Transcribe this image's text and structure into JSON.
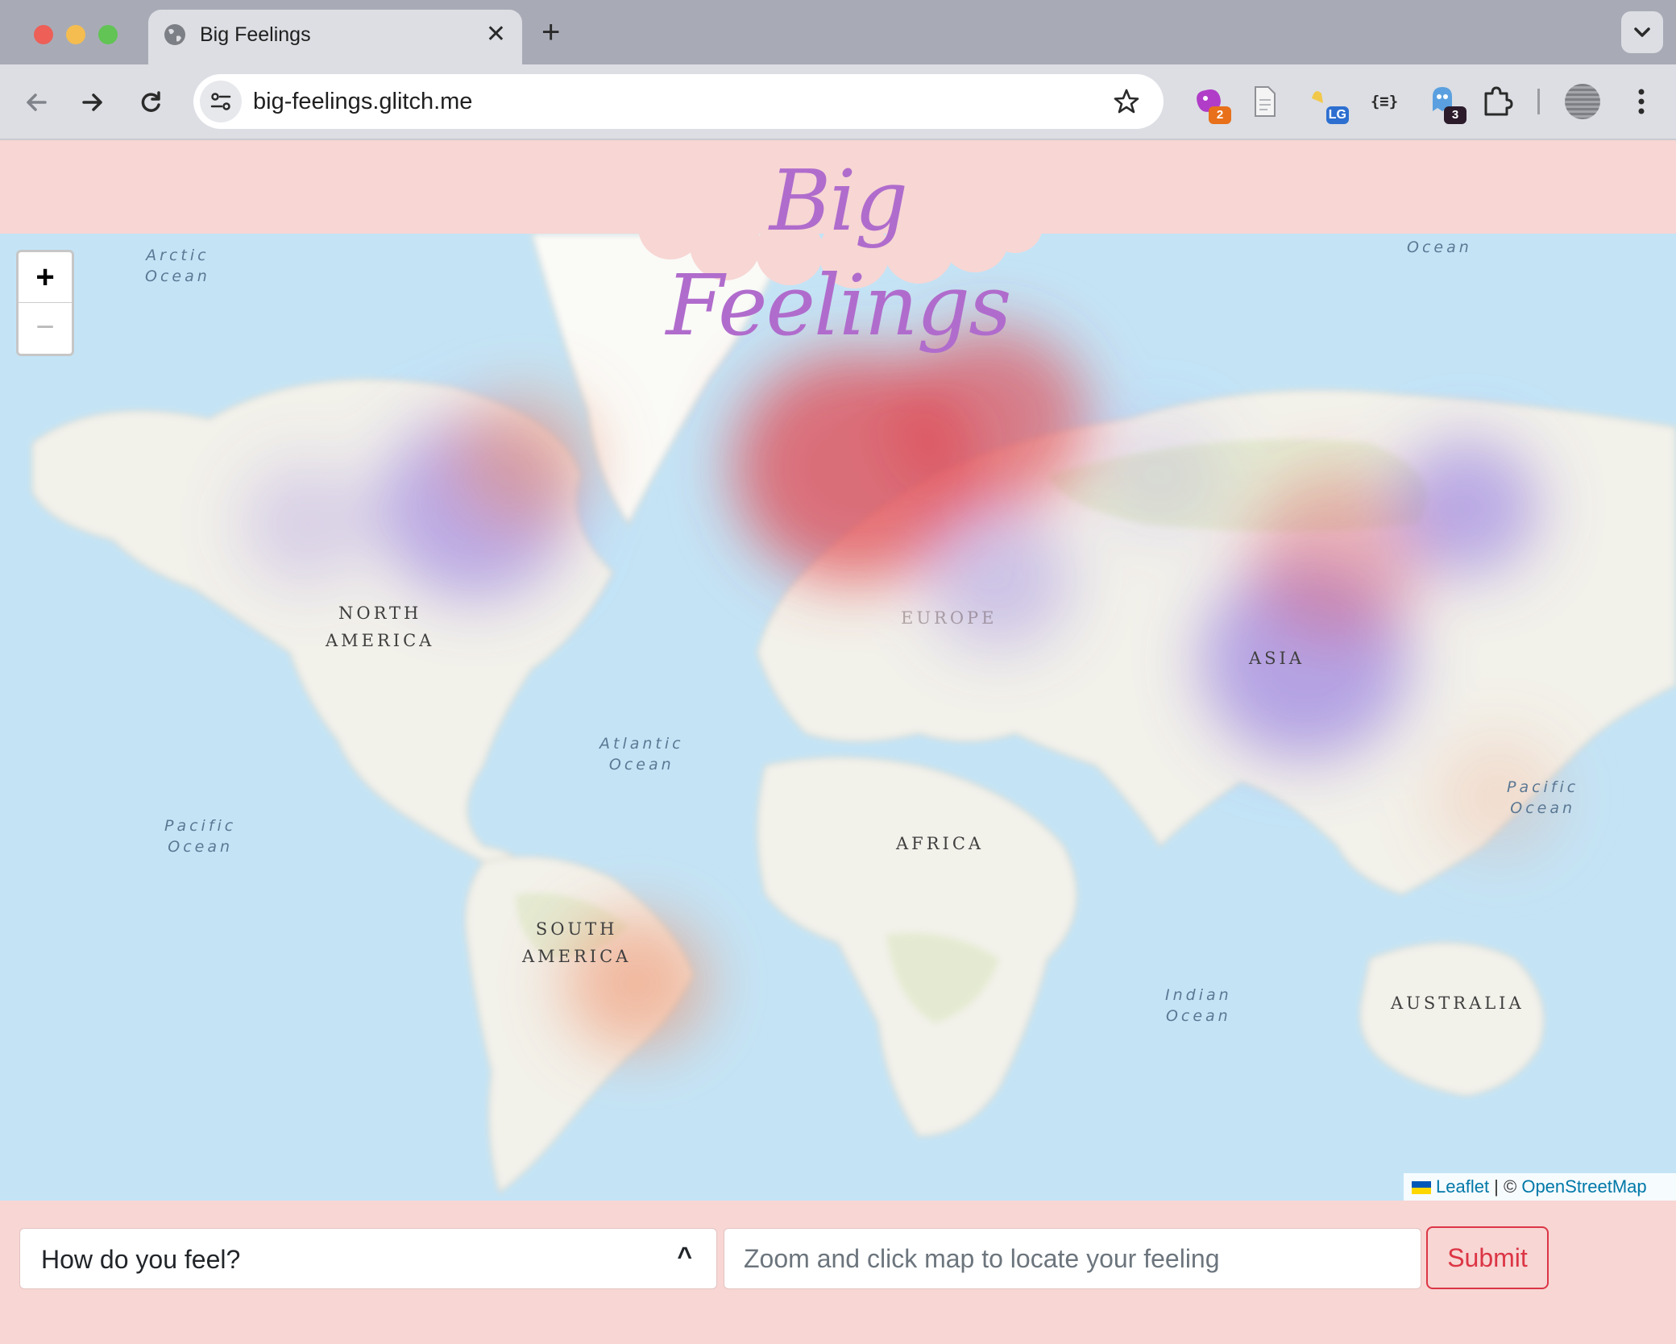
{
  "browser": {
    "tab_title": "Big Feelings",
    "tab_close_glyph": "✕",
    "new_tab_glyph": "+",
    "url": "big-feelings.glitch.me",
    "extensions": [
      {
        "icon": "purple-blob-extension-icon",
        "badge": "2",
        "badge_color": "#e8701a"
      },
      {
        "icon": "document-extension-icon",
        "badge": ""
      },
      {
        "icon": "lg-extension-icon",
        "badge": "LG",
        "badge_color": "#2d6fd0"
      },
      {
        "icon": "json-extension-icon",
        "label": "{≡}"
      },
      {
        "icon": "ghost-extension-icon",
        "badge": "3",
        "badge_color": "#2b1b2b"
      },
      {
        "icon": "puzzle-extensions-icon",
        "badge": ""
      }
    ]
  },
  "page": {
    "title": "Big Feelings",
    "title_color": "#b06ccc",
    "header_bg": "#f7d6d4"
  },
  "map": {
    "zoom_in_label": "+",
    "zoom_out_label": "−",
    "continents": [
      "NORTH",
      "AMERICA",
      "SOUTH",
      "AMERICA",
      "EUROPE",
      "AFRICA",
      "ASIA",
      "AUSTRALIA"
    ],
    "oceans": {
      "arctic": [
        "Arctic",
        "Ocean"
      ],
      "ocean_ne": "Ocean",
      "atlantic": [
        "Atlantic",
        "Ocean"
      ],
      "pacific_w": [
        "Pacific",
        "Ocean"
      ],
      "pacific_e": [
        "Pacific",
        "Ocean"
      ],
      "indian": [
        "Indian",
        "Ocean"
      ]
    },
    "heat_colors": {
      "warm": "#e0454f",
      "cool": "#8a6ee0",
      "orange": "#f08a60"
    },
    "attribution": {
      "leaflet": "Leaflet",
      "separator": " | © ",
      "osm": "OpenStreetMap"
    }
  },
  "form": {
    "select_label": "How do you feel?",
    "select_caret": "^",
    "location_placeholder": "Zoom and click map to locate your feeling",
    "submit_label": "Submit",
    "submit_color": "#dc3545"
  }
}
